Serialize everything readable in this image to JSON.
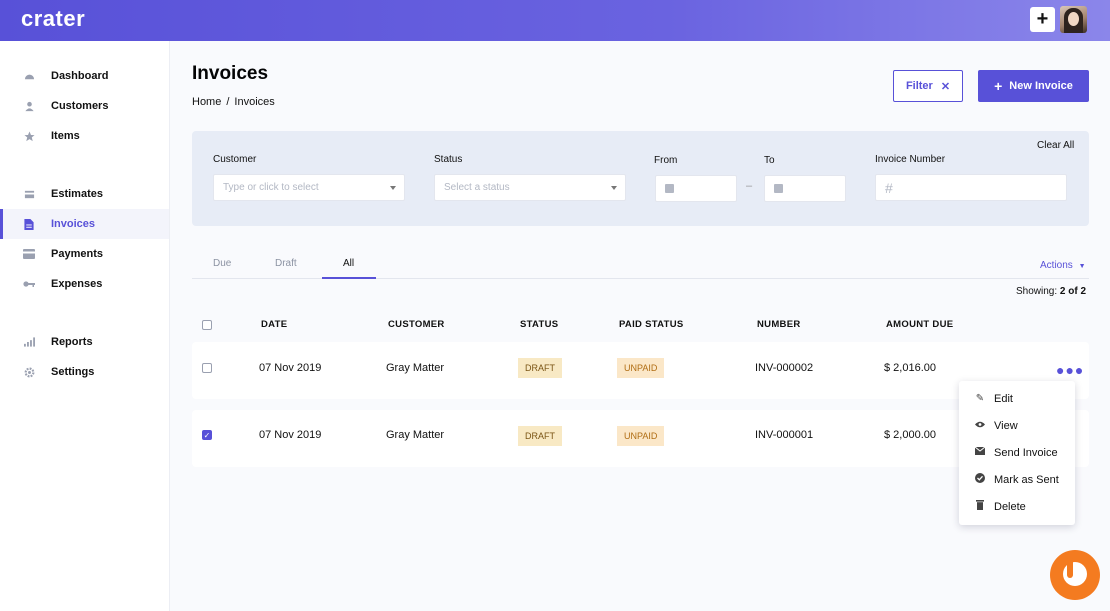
{
  "app": {
    "logo": "crater",
    "add_symbol": "+"
  },
  "sidebar": {
    "items": [
      {
        "label": "Dashboard",
        "icon": "dashboard-icon",
        "active": false
      },
      {
        "label": "Customers",
        "icon": "user-icon",
        "active": false
      },
      {
        "label": "Items",
        "icon": "star-icon",
        "active": false
      },
      {
        "label": "Estimates",
        "icon": "document-icon",
        "active": false
      },
      {
        "label": "Invoices",
        "icon": "invoice-icon",
        "active": true
      },
      {
        "label": "Payments",
        "icon": "credit-card-icon",
        "active": false
      },
      {
        "label": "Expenses",
        "icon": "key-icon",
        "active": false
      },
      {
        "label": "Reports",
        "icon": "bar-chart-icon",
        "active": false
      },
      {
        "label": "Settings",
        "icon": "gear-icon",
        "active": false
      }
    ]
  },
  "page": {
    "title": "Invoices",
    "breadcrumb": [
      "Home",
      "/",
      "Invoices"
    ]
  },
  "toolbar": {
    "filter_label": "Filter",
    "filter_close": "✕",
    "new_label": "New Invoice",
    "new_icon": "+"
  },
  "filters": {
    "clear_all": "Clear All",
    "customer": {
      "label": "Customer",
      "placeholder": "Type or click to select"
    },
    "status": {
      "label": "Status",
      "placeholder": "Select a status"
    },
    "from": {
      "label": "From"
    },
    "to": {
      "label": "To"
    },
    "range_dash": "–",
    "invoice_number": {
      "label": "Invoice Number",
      "symbol": "#"
    }
  },
  "tabs": [
    {
      "label": "Due",
      "active": false
    },
    {
      "label": "Draft",
      "active": false
    },
    {
      "label": "All",
      "active": true
    }
  ],
  "actions_label": "Actions",
  "showing": {
    "prefix": "Showing:",
    "count": "2 of 2"
  },
  "table": {
    "headers": [
      "DATE",
      "CUSTOMER",
      "STATUS",
      "PAID STATUS",
      "NUMBER",
      "AMOUNT DUE"
    ],
    "rows": [
      {
        "date": "07 Nov 2019",
        "customer": "Gray Matter",
        "status": "DRAFT",
        "paid_status": "UNPAID",
        "number": "INV-000002",
        "amount": "$ 2,016.00",
        "checked": false
      },
      {
        "date": "07 Nov 2019",
        "customer": "Gray Matter",
        "status": "DRAFT",
        "paid_status": "UNPAID",
        "number": "INV-000001",
        "amount": "$ 2,000.00",
        "checked": true
      }
    ]
  },
  "row_menu": {
    "items": [
      {
        "label": "Edit",
        "icon": "pencil-icon"
      },
      {
        "label": "View",
        "icon": "eye-icon"
      },
      {
        "label": "Send Invoice",
        "icon": "envelope-icon"
      },
      {
        "label": "Mark as Sent",
        "icon": "check-circle-icon"
      },
      {
        "label": "Delete",
        "icon": "trash-icon"
      }
    ]
  },
  "colors": {
    "primary": "#5851d8",
    "draft_bg": "#f8e9c4",
    "unpaid_bg": "#fbe7c8",
    "brand_badge": "#f47b20"
  }
}
